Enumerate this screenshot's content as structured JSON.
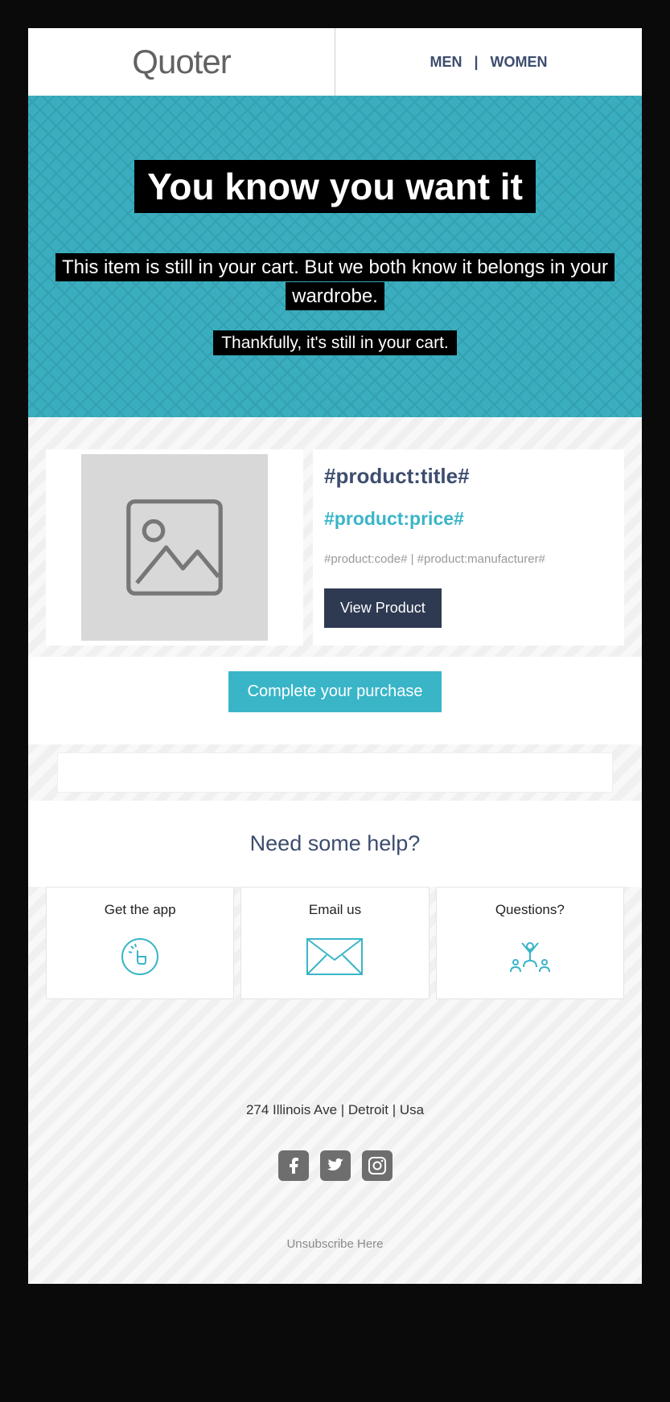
{
  "header": {
    "logo": "Quoter",
    "nav_men": "MEN",
    "nav_women": "WOMEN",
    "nav_sep": "|"
  },
  "hero": {
    "title": "You know you want it",
    "line1": "This item is still in your cart. But we both know it belongs in your wardrobe.",
    "line2": "Thankfully, it's still in your cart."
  },
  "product": {
    "title": "#product:title#",
    "price": "#product:price#",
    "meta": "#product:code# | #product:manufacturer#",
    "view_btn": "View Product"
  },
  "cta": {
    "complete": "Complete your purchase"
  },
  "help": {
    "title": "Need some help?",
    "cards": [
      {
        "label": "Get the app"
      },
      {
        "label": "Email us"
      },
      {
        "label": "Questions?"
      }
    ]
  },
  "footer": {
    "address": "274 Illinois Ave   |   Detroit   |    Usa",
    "unsubscribe": "Unsubscribe Here"
  }
}
